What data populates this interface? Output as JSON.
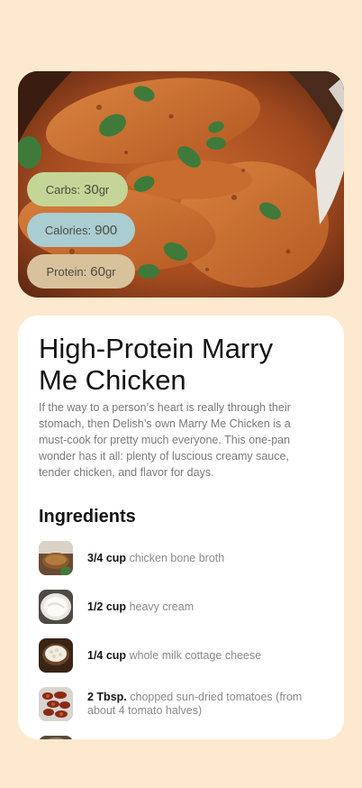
{
  "nutrition": {
    "carbs": {
      "label": "Carbs:",
      "value": "30",
      "unit": "gr"
    },
    "calories": {
      "label": "Calories:",
      "value": "900",
      "unit": ""
    },
    "protein": {
      "label": "Protein:",
      "value": "60",
      "unit": "gr"
    }
  },
  "recipe": {
    "title": "High-Protein Marry Me Chicken",
    "description": "If the way to a person’s heart is really through their stomach, then Delish’s own Marry Me Chicken is a must-cook for pretty much everyone. This one-pan wonder has it all: plenty of luscious creamy sauce, tender chicken, and flavor for days."
  },
  "ingredients": {
    "heading": "Ingredients",
    "items": [
      {
        "amount": "3/4 cup",
        "name": "chicken bone broth",
        "icon": "broth-thumbnail"
      },
      {
        "amount": "1/2 cup",
        "name": "heavy cream",
        "icon": "cream-thumbnail"
      },
      {
        "amount": "1/4 cup",
        "name": "whole milk cottage cheese",
        "icon": "cottage-cheese-thumbnail"
      },
      {
        "amount": "2 Tbsp.",
        "name": "chopped sun-dried tomatoes (from about 4 tomato halves)",
        "icon": "tomatoes-thumbnail"
      }
    ]
  }
}
